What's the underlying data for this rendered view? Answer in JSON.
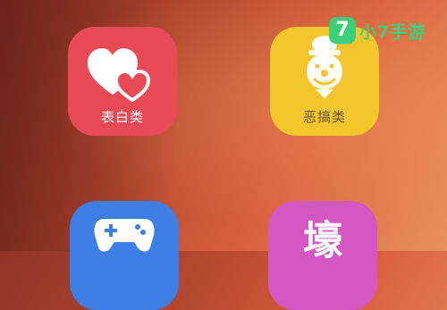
{
  "apps": [
    {
      "label": "表白类",
      "icon": "hearts-icon",
      "color": "#ea4a56"
    },
    {
      "label": "恶搞类",
      "icon": "clown-icon",
      "color": "#f5c52c"
    },
    {
      "label": "",
      "icon": "gamepad-icon",
      "color": "#3d7fe6"
    },
    {
      "label": "",
      "glyph": "壕",
      "icon": "rank-glyph-icon",
      "color": "#d557c4"
    }
  ],
  "watermark": {
    "mark": "7",
    "text": "小7手游",
    "color": "#3ccf7a"
  }
}
